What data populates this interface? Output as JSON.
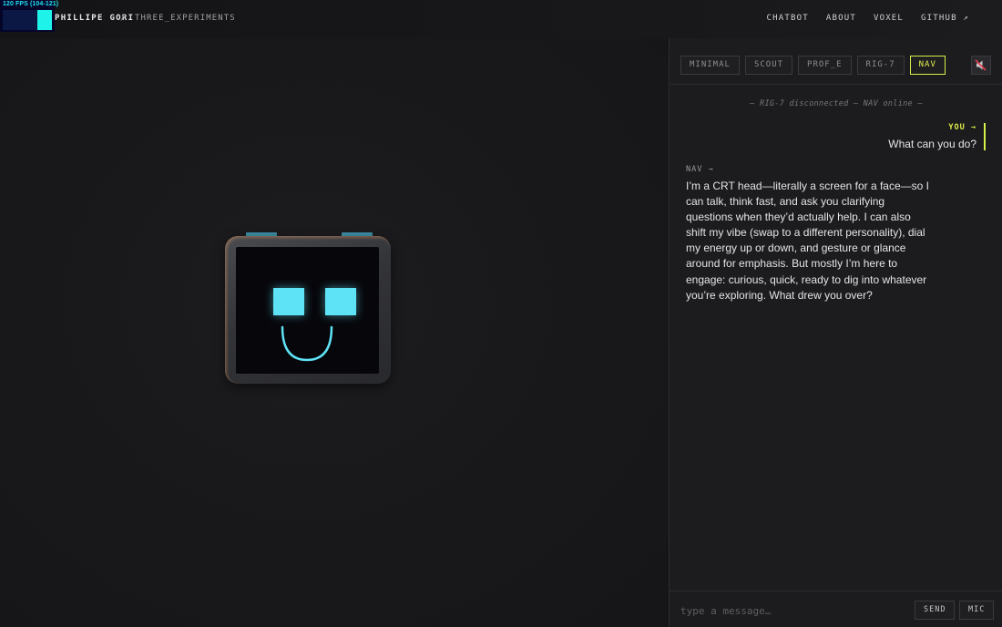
{
  "fps": {
    "label": "120 FPS (104-121)"
  },
  "header": {
    "brand": "PHILLIPE GORI",
    "separator": "/",
    "crumb": "THREE_EXPERIMENTS",
    "nav": [
      {
        "label": "CHATBOT"
      },
      {
        "label": "ABOUT"
      },
      {
        "label": "VOXEL"
      },
      {
        "label": "GITHUB ↗"
      }
    ]
  },
  "robot": {
    "screen_color": "#07070b",
    "face_color": "#5ee3f6",
    "ear_color": "#3e8ea6"
  },
  "chat": {
    "personas": [
      {
        "label": "MINIMAL",
        "active": false
      },
      {
        "label": "SCOUT",
        "active": false
      },
      {
        "label": "PROF_E",
        "active": false
      },
      {
        "label": "RIG-7",
        "active": false
      },
      {
        "label": "NAV",
        "active": true
      }
    ],
    "mute_icon": "speaker-muted-icon",
    "accent": "#d8ee4a",
    "system_message": "— RIG-7 disconnected — NAV online —",
    "messages": [
      {
        "role": "user",
        "label": "YOU →",
        "text": "What can you do?"
      },
      {
        "role": "bot",
        "label": "NAV →",
        "text": "I’m a CRT head—literally a screen for a face—so I can talk, think fast, and ask you clarifying questions when they’d actually help. I can also shift my vibe (swap to a different personality), dial my energy up or down, and gesture or glance around for emphasis. But mostly I’m here to engage: curious, quick, ready to dig into whatever you’re exploring. What drew you over?"
      }
    ],
    "composer": {
      "placeholder": "type a message…",
      "send_label": "SEND",
      "mic_label": "MIC"
    }
  }
}
